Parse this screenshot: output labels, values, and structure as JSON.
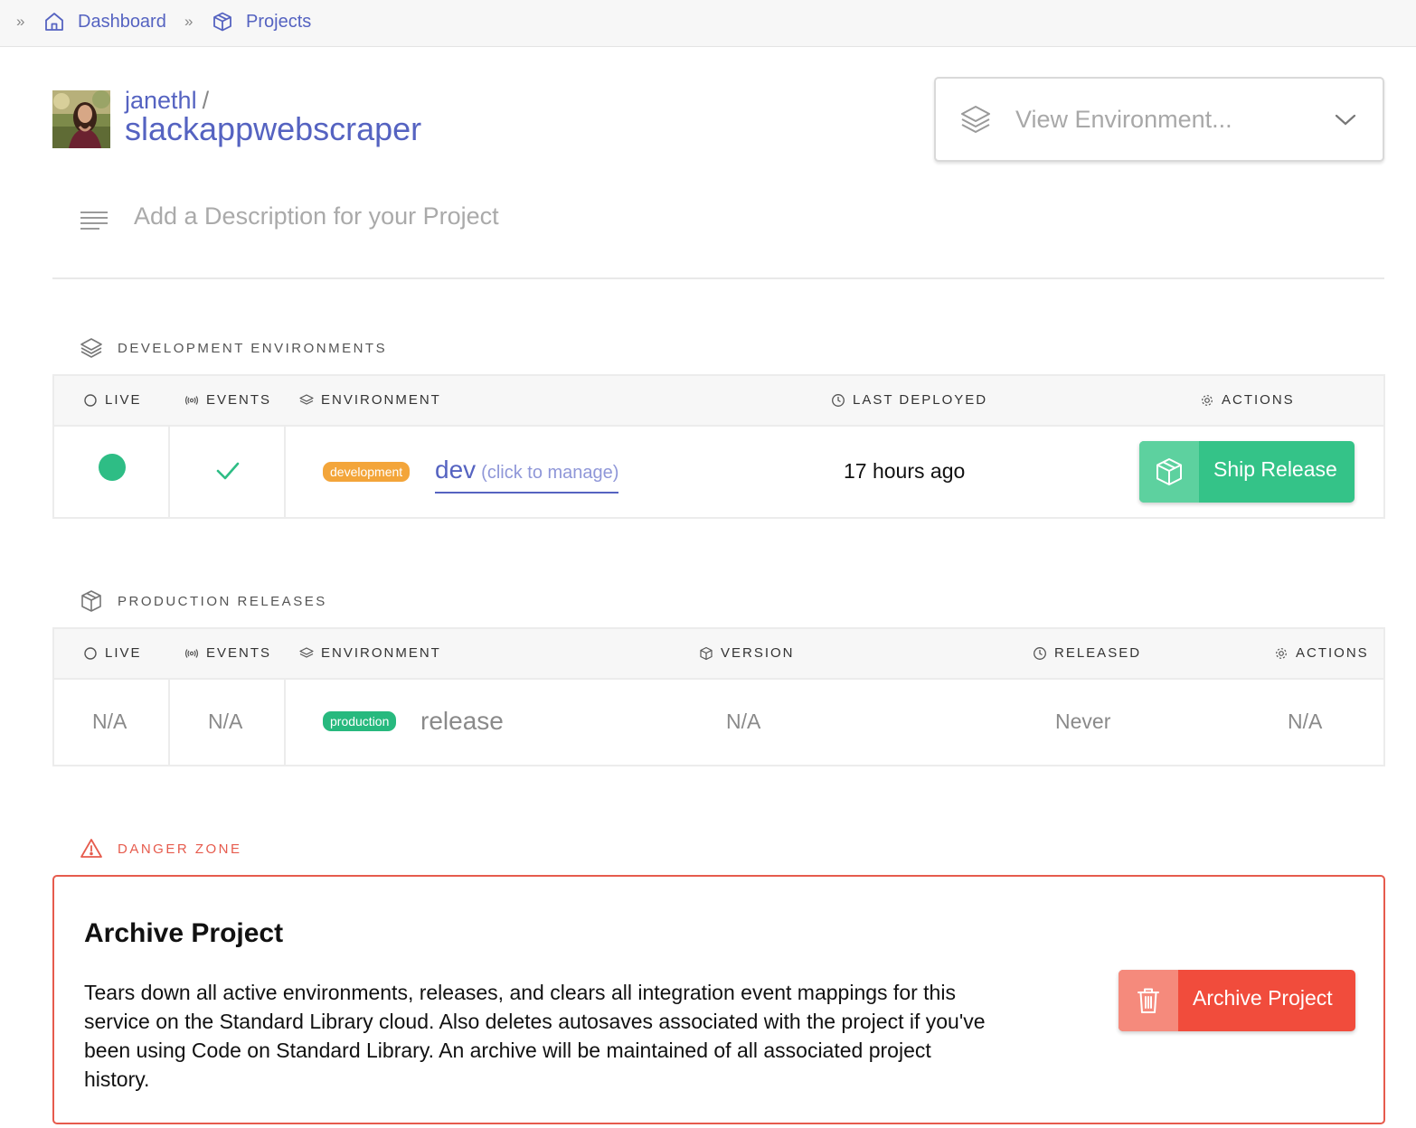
{
  "breadcrumb": {
    "separator": "»",
    "items": [
      {
        "label": "Dashboard",
        "icon": "home-icon"
      },
      {
        "label": "Projects",
        "icon": "cube-icon"
      }
    ]
  },
  "project": {
    "owner": "janethl",
    "slash": "/",
    "name": "slackappwebscraper",
    "description_placeholder": "Add a Description for your Project"
  },
  "environment_select": {
    "placeholder": "View Environment...",
    "icon": "layers-icon"
  },
  "development": {
    "heading": "DEVELOPMENT ENVIRONMENTS",
    "columns": {
      "live": "LIVE",
      "events": "EVENTS",
      "environment": "ENVIRONMENT",
      "last_deployed": "LAST DEPLOYED",
      "actions": "ACTIONS"
    },
    "row": {
      "live": true,
      "events_ok": true,
      "badge": "development",
      "env_name": "dev",
      "manage_hint": "(click to manage)",
      "last_deployed": "17 hours ago",
      "action_label": "Ship Release"
    }
  },
  "production": {
    "heading": "PRODUCTION RELEASES",
    "columns": {
      "live": "LIVE",
      "events": "EVENTS",
      "environment": "ENVIRONMENT",
      "version": "VERSION",
      "released": "RELEASED",
      "actions": "ACTIONS"
    },
    "row": {
      "live": "N/A",
      "events": "N/A",
      "badge": "production",
      "env_name": "release",
      "version": "N/A",
      "released": "Never",
      "actions": "N/A"
    }
  },
  "danger": {
    "heading": "DANGER ZONE",
    "title": "Archive Project",
    "text": "Tears down all active environments, releases, and clears all integration event mappings for this service on the Standard Library cloud. Also deletes autosaves associated with the project if you've been using Code on Standard Library. An archive will be maintained of all associated project history.",
    "button_label": "Archive Project"
  },
  "colors": {
    "link": "#5563c1",
    "success": "#2ebd85",
    "warning_badge": "#f3a53a",
    "danger": "#e65b4d"
  }
}
